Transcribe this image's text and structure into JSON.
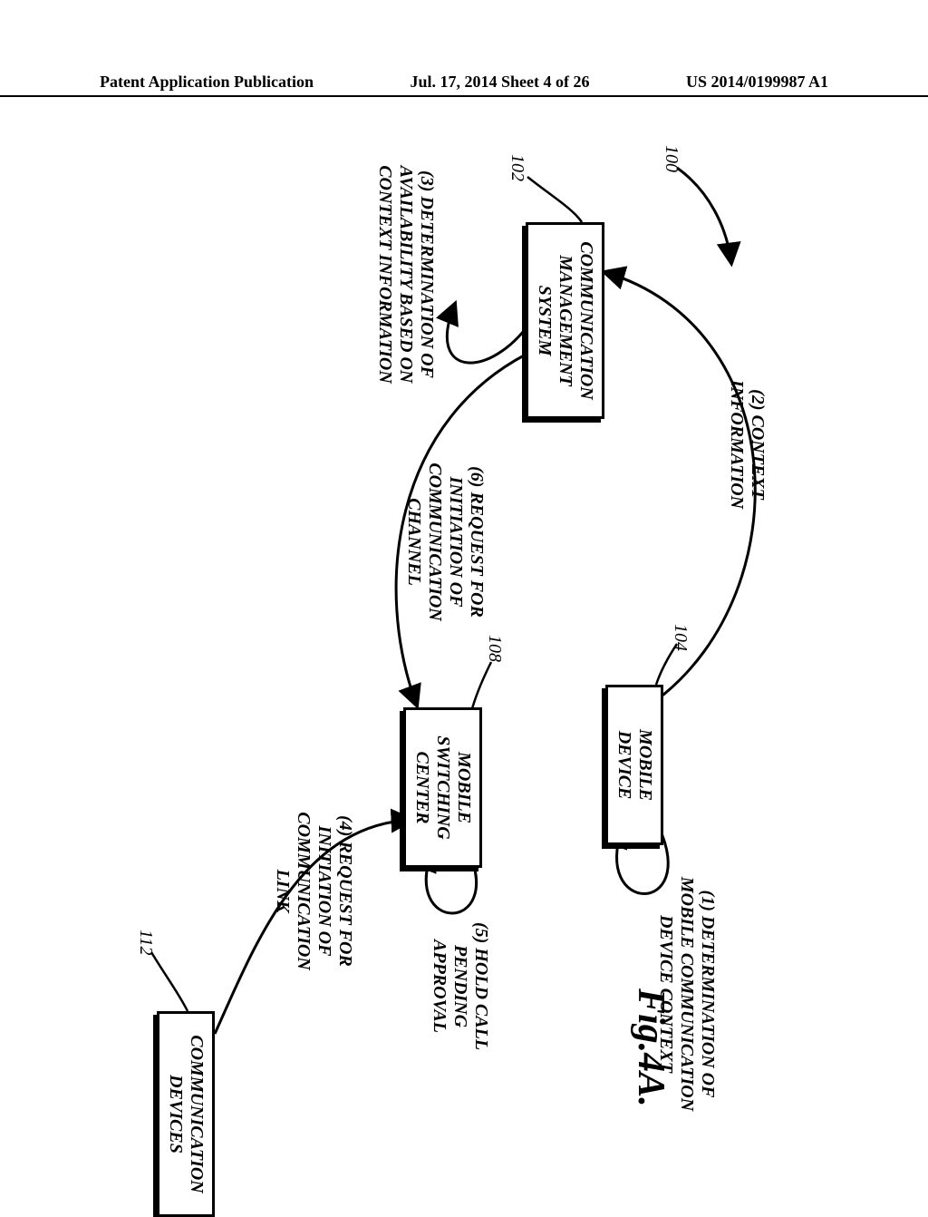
{
  "header": {
    "left": "Patent Application Publication",
    "center": "Jul. 17, 2014  Sheet 4 of 26",
    "right": "US 2014/0199987 A1"
  },
  "refs": {
    "r100": "100",
    "r102": "102",
    "r104": "104",
    "r108": "108",
    "r112": "112"
  },
  "boxes": {
    "cms": "COMMUNICATION MANAGEMENT SYSTEM",
    "mobile": "MOBILE DEVICE",
    "msc": "MOBILE SWITCHING CENTER",
    "commdev": "COMMUNICATION DEVICES"
  },
  "labels": {
    "l1": "(1) DETERMINATION OF MOBILE COMMUNICATION DEVICE CONTEXT",
    "l2": "(2) CONTEXT INFORMATION",
    "l3": "(3) DETERMINATION OF AVAILABILITY BASED ON CONTEXT INFORMATION",
    "l4": "(4) REQUEST FOR INITIATION OF COMMUNICATION LINK",
    "l5": "(5) HOLD CALL PENDING APPROVAL",
    "l6": "(6) REQUEST FOR INITIATION OF COMMUNICATION CHANNEL"
  },
  "fig": "Fig.4A."
}
